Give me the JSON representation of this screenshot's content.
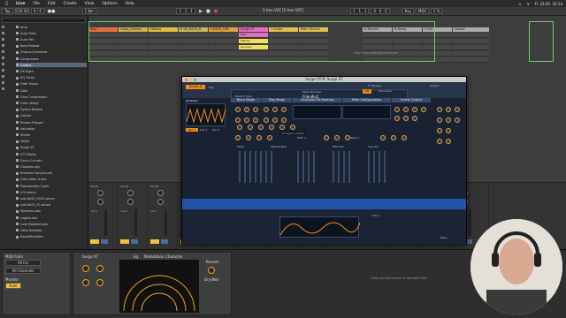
{
  "menubar": {
    "app": "Live",
    "items": [
      "File",
      "Edit",
      "Create",
      "View",
      "Options",
      "Help"
    ],
    "right_text": "Fr. 23.05. 10:14"
  },
  "transport": {
    "tap": "Tap",
    "tempo": "120.00",
    "meter": "4 / 4",
    "bar": "1 Bar",
    "position": "1 . 1 . 1",
    "loop_start": "1 . 1 . 1",
    "loop_len": "4 . 0 . 0",
    "key": "Key",
    "midi": "MIDI",
    "cpu": "5 %"
  },
  "document_title": "5 free VST  [5 free VST]",
  "browser": {
    "items": [
      "Amp",
      "Auto Filter",
      "Auto Pan",
      "Beat Repeat",
      "Chorus-Ensemble",
      "Compressor",
      "Corpus",
      "DS Eight",
      "EQ Three",
      "Filter Delay",
      "Gate",
      "Glue Compressor",
      "Grain Delay",
      "Hybrid Reverb",
      "Limiter",
      "Phaser-Flanger",
      "Saturator",
      "Shifter",
      "Utility",
      "Surge XT",
      "ZT3 Radio",
      "Drum Cut.adv",
      "Glassies.adv",
      "Ethereal Canyon.adv",
      "Granulator II.adv",
      "Pianosorbite II.adv",
      "LFO.amxd",
      "sub-BASS_VOL2.amxd",
      "sub-BASS_X1.amxd",
      "Melodies.adv",
      "Legato.adv",
      "Lush Radiator.adv",
      "Little Radiator",
      "RapidShredder"
    ],
    "selected_index": 6,
    "categories": [
      "Sounds",
      "Drums",
      "Instruments",
      "Audio Effects",
      "MIDI Effects",
      "Max for Live",
      "Plug-Ins",
      "Clips",
      "Samples",
      "Grooves",
      "Templates"
    ]
  },
  "session": {
    "tracks": [
      {
        "name": "Rise",
        "color": "#e07040"
      },
      {
        "name": "Clapz_Snares",
        "color": "#d0b050"
      },
      {
        "name": "Melody",
        "color": "#e0c040"
      },
      {
        "name": "6 VK_BACK_B",
        "color": "#c8b860"
      },
      {
        "name": "LADDR_LPB",
        "color": "#e0a040"
      },
      {
        "name": "Surge XT",
        "color": "#e070c0"
      },
      {
        "name": "7 Audio",
        "color": "#e0c050"
      },
      {
        "name": "Main Techno",
        "color": "#e0c050"
      },
      {
        "name": "A Reverb",
        "color": "#aaaaaa"
      },
      {
        "name": "B Delay",
        "color": "#aaaaaa"
      },
      {
        "name": "C Ext",
        "color": "#aaaaaa"
      },
      {
        "name": "Master",
        "color": "#aaaaaa"
      }
    ],
    "clips": [
      {
        "track": 5,
        "row": 0,
        "name": "Bass",
        "color": "#e070c0"
      },
      {
        "track": 5,
        "row": 1,
        "name": "Melody",
        "color": "#f0e060"
      },
      {
        "track": 5,
        "row": 2,
        "name": "Gnomes",
        "color": "#f0e060"
      }
    ],
    "drop_hint": "Drop Files and Devices Here"
  },
  "mixer": {
    "sends_label": "Sends",
    "volumes": [
      "-15.2",
      "-11.6",
      "-0.0",
      "-17.4",
      "-10.8",
      "0",
      "-19.4",
      "-4.5",
      "0",
      "0",
      "0",
      "0"
    ]
  },
  "plugin": {
    "window_title": "Surge XT/9: Surge XT",
    "patch_browser_label": "Patch Browser",
    "patch_name": "Friendly2",
    "category": "Electric Keys",
    "fx_bypass": "FX Bypass",
    "character": "Character",
    "output": "Output",
    "scene": "Scene A",
    "sections": [
      "Oscillator",
      "Mixer",
      "Filter Configuration",
      "Amp EG",
      "Filter EG"
    ],
    "tabs": [
      "Bend Depth",
      "Play Mode",
      "Oscillator FM Routing",
      "Filter Configuration",
      "Scene Output"
    ],
    "osc_labels": [
      "Osc 1",
      "Osc 2",
      "Osc 3"
    ],
    "filter1": "Filter 1",
    "filter2": "Filter 2",
    "waveshaper": "Waveshaper",
    "lp_legacy": "LP Legacy Ladder",
    "lfo_label": "LFO 1",
    "menu_label": "Menu",
    "zoom": "100 %"
  },
  "devices": {
    "input_label": "MIDI From",
    "input_value": "All Ins",
    "channel": "All Channels",
    "monitor": "Monitor",
    "surge_title": "Surge XT",
    "auto_label": "Auto",
    "drop_hint": "Drop an Instrument or Sample Here",
    "eq_tab": "Eq",
    "mod_tab": "Modulation",
    "char_tab": "Character",
    "reverb_label": "Reverb",
    "dry_wet": "Dry/Wet"
  },
  "colors": {
    "accent_orange": "#f28a1a",
    "surge_blue": "#2454a8",
    "selection_green": "#6ad06a"
  }
}
